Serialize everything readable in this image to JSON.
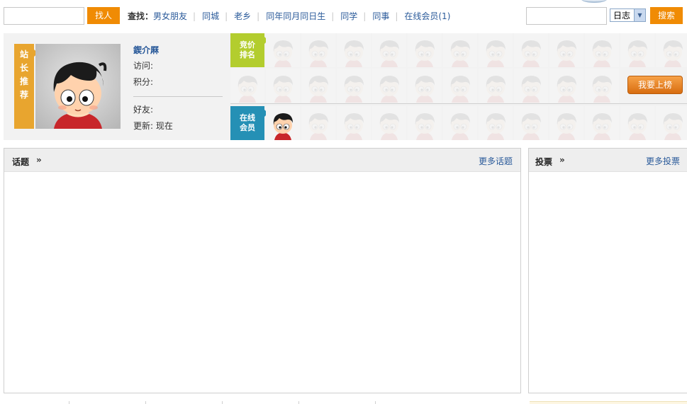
{
  "topbar": {
    "people_search_value": "",
    "people_search_button": "找人",
    "find_label": "查找：",
    "find_links": [
      "男女朋友",
      "同城",
      "老乡",
      "同年同月同日生",
      "同学",
      "同事",
      "在线会员(1)"
    ],
    "site_search_value": "",
    "search_type": "日志",
    "search_button": "搜索"
  },
  "feature": {
    "recommend_label": "站长推荐",
    "profile": {
      "name": "鍥介厤",
      "visits": "访问:",
      "points": "积分:",
      "friends": "好友:",
      "updated": "更新: 现在"
    },
    "bid_rank_label": "竞价排名",
    "online_label": "在线会员",
    "rank_button": "我要上榜",
    "online_member_count": 1
  },
  "panels": {
    "topics": {
      "title": "话题",
      "arrow": "»",
      "more": "更多话题"
    },
    "polls": {
      "title": "投票",
      "arrow": "»",
      "more": "更多投票"
    }
  },
  "colors": {
    "orange_button": "#f08b04",
    "recommend_tag": "#e8a52f",
    "bid_rank_tag": "#b3cd2e",
    "online_tag": "#2590b5",
    "link": "#2a5a9a"
  }
}
